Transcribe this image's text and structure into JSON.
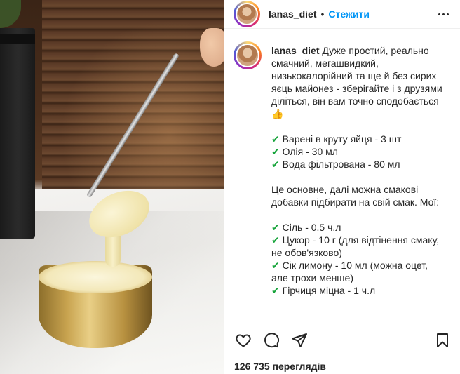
{
  "post": {
    "username": "lanas_diet",
    "separator": "•",
    "follow_label": "Стежити",
    "more_icon": "more-horizontal-icon"
  },
  "caption": {
    "username": "lanas_diet",
    "intro": "Дуже простий, реально смачний, мегашвидкий, низькокалорійний та ще й без сирих яєць майонез - зберігайте і з друзями діліться, він вам точно сподобається",
    "intro_emoji": "👍",
    "check_mark": "✔",
    "ingredients": [
      "Варені в круту яйця - 3 шт",
      "Олія - 30 мл",
      "Вода фільтрована - 80 мл"
    ],
    "extra_note": "Це основне, далі можна смакові добавки підбирати на свій смак. Мої:",
    "extras": [
      "Сіль - 0.5 ч.л",
      "Цукор - 10 г (для відтінення смаку, не обов'язково)",
      "Сік лимону - 10 мл (можна оцет, але трохи менше)",
      "Гірчиця міцна - 1 ч.л"
    ]
  },
  "actions": {
    "like_icon": "heart-icon",
    "comment_icon": "comment-icon",
    "share_icon": "paper-plane-icon",
    "save_icon": "bookmark-icon"
  },
  "stats": {
    "views": "126 735 переглядів"
  },
  "colors": {
    "follow": "#0095f6",
    "text": "#262626",
    "check": "#17a43b",
    "divider": "#efefef"
  }
}
